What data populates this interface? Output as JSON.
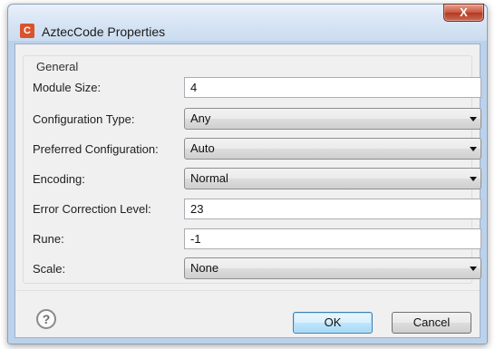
{
  "window": {
    "app_icon_letter": "C",
    "title": "AztecCode Properties",
    "close_glyph": "X"
  },
  "group": {
    "label": "General"
  },
  "fields": {
    "module_size": {
      "label": "Module Size:",
      "value": "4"
    },
    "configuration_type": {
      "label": "Configuration Type:",
      "value": "Any"
    },
    "preferred_configuration": {
      "label": "Preferred Configuration:",
      "value": "Auto"
    },
    "encoding": {
      "label": "Encoding:",
      "value": "Normal"
    },
    "error_correction_level": {
      "label": "Error Correction Level:",
      "value": "23"
    },
    "rune": {
      "label": "Rune:",
      "value": "-1"
    },
    "scale": {
      "label": "Scale:",
      "value": "None"
    }
  },
  "footer": {
    "help_glyph": "?",
    "ok_label": "OK",
    "cancel_label": "Cancel"
  },
  "icons": {
    "app": "app-logo-icon",
    "close": "close-icon",
    "help": "help-icon",
    "dropdown": "chevron-down-icon"
  },
  "colors": {
    "app_icon": "#d9532c",
    "close_button": "#c9533c",
    "default_button_border": "#3c7fb1"
  }
}
